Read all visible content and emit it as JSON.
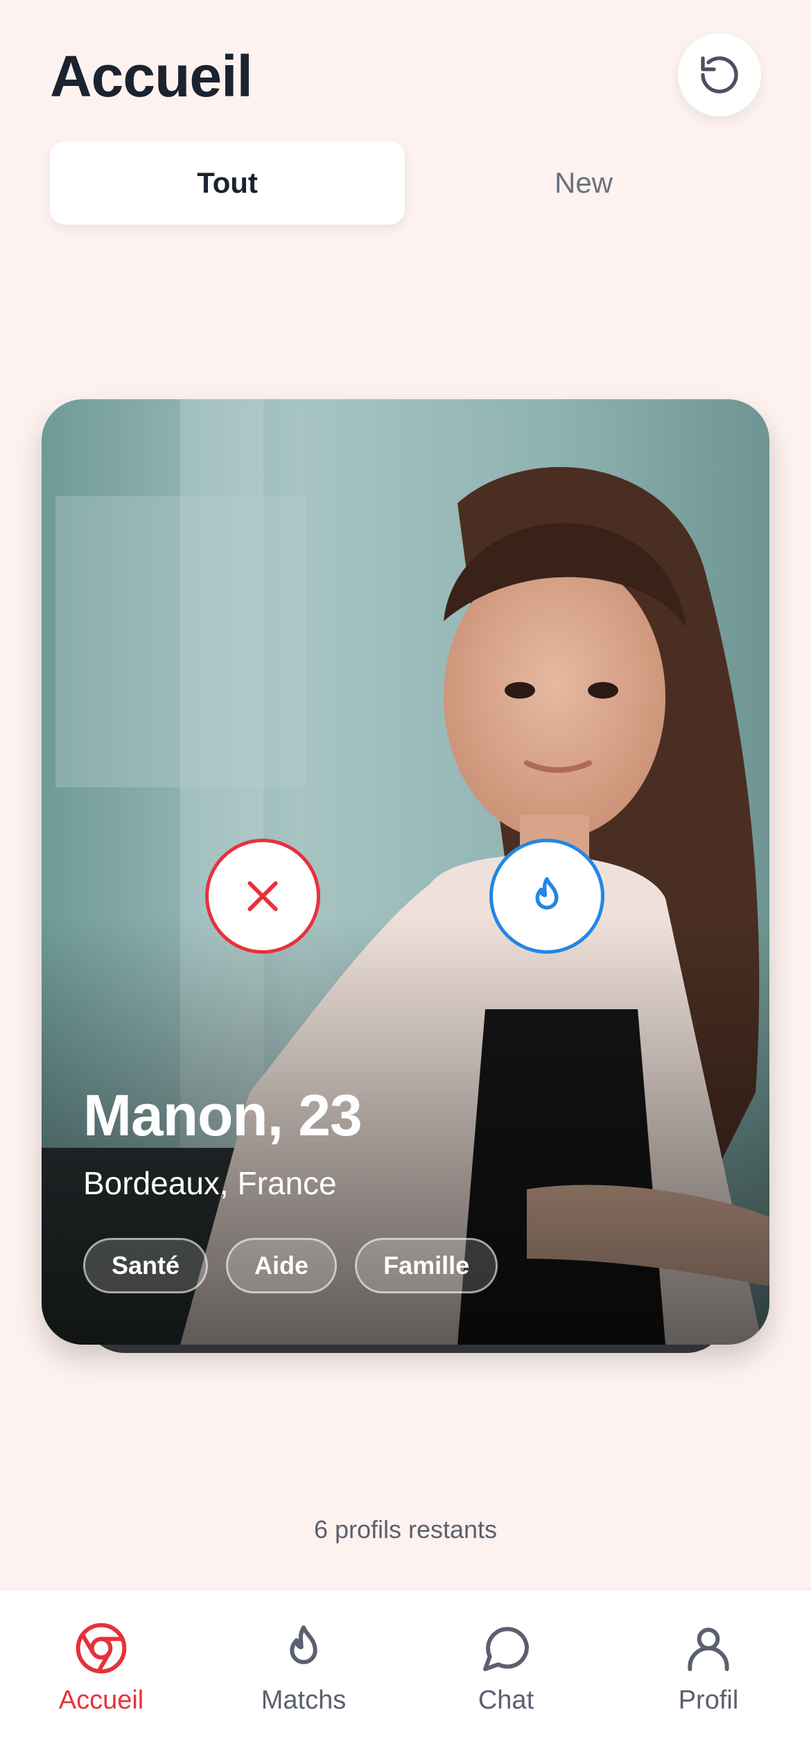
{
  "header": {
    "title": "Accueil",
    "reset_icon": "rotate-ccw-icon"
  },
  "tabs": [
    {
      "label": "Tout",
      "active": true
    },
    {
      "label": "New",
      "active": false
    }
  ],
  "card": {
    "name_age": "Manon, 23",
    "location": "Bordeaux, France",
    "tags": [
      "Santé",
      "Aide",
      "Famille"
    ],
    "pass_icon": "close-icon",
    "like_icon": "flame-icon"
  },
  "remaining_text": "6 profils restants",
  "bottom_nav": [
    {
      "label": "Accueil",
      "icon": "aperture-icon",
      "active": true
    },
    {
      "label": "Matchs",
      "icon": "flame-icon",
      "active": false
    },
    {
      "label": "Chat",
      "icon": "chat-bubble-icon",
      "active": false
    },
    {
      "label": "Profil",
      "icon": "user-icon",
      "active": false
    }
  ],
  "colors": {
    "background": "#fdf2ef",
    "accent_red": "#e8313a",
    "accent_blue": "#2286e6",
    "text_dark": "#1b2230",
    "text_muted": "#5b6070"
  }
}
